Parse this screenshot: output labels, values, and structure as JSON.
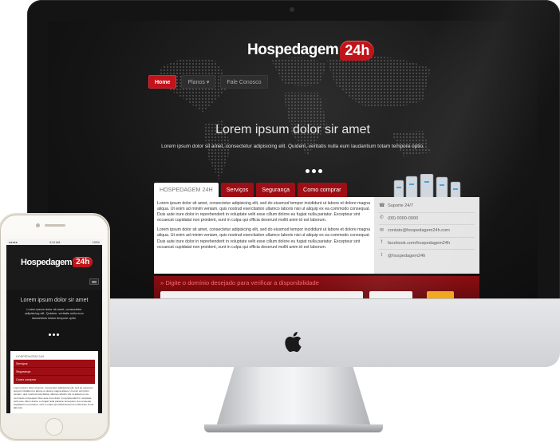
{
  "website": {
    "logo_word": "Hospedagem",
    "logo_badge": "24h",
    "nav": [
      "Home",
      "Planos",
      "Fale Conosco"
    ],
    "hero_title": "Lorem ipsum dolor sir amet",
    "hero_text": "Lorem ipsum dolor sit amet, consectetur adipisicing elit. Quidem, veritatis nulla eum laudantium totam tempore optio.",
    "tabs": [
      "HOSPEDAGEM 24H",
      "Serviços",
      "Segurança",
      "Como comprar"
    ],
    "paragraph": "Lorem ipsum dolor sit amet, consectetur adipisicing elit, sed do eiusmod tempor incididunt ut labore et dolore magna aliqua. Ut enim ad minim veniam, quis nostrud exercitation ullamco laboris nisi ut aliquip ex ea commodo consequat. Duis aute irure dolor in reprehenderit in voluptate velit esse cillum dolore eu fugiat nulla pariatur. Excepteur sint occaecat cupidatat non proident, sunt in culpa qui officia deserunt mollit anim id est laborum.",
    "contact": {
      "support": "Suporte 24/7",
      "phone": "(00) 0000-0000",
      "email": "contato@hospedagem24h.com",
      "facebook": "facebook.com/hospedagem24h",
      "twitter": "@hospedagem24h"
    },
    "domain_prompt": "» Digite o domínio desejado para verificar a disponibilidade"
  },
  "mobile": {
    "status_left": "●●●●● ",
    "status_time": "9:41 AM",
    "status_right": "100%",
    "content_tabs": [
      "HOSPEDAGEM 24H",
      "Serviços",
      "Segurança",
      "Como comprar"
    ]
  },
  "colors": {
    "brand_red": "#c3131a",
    "dark_red": "#9e0f15",
    "orange_button": "#f0a81c"
  }
}
